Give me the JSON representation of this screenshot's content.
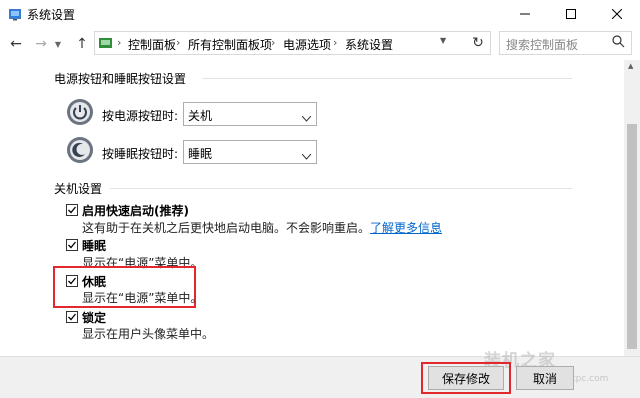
{
  "window": {
    "title": "系统设置"
  },
  "nav": {
    "breadcrumb": [
      "控制面板",
      "所有控制面板项",
      "电源选项",
      "系统设置"
    ],
    "search_placeholder": "搜索控制面板"
  },
  "power_section": {
    "title": "电源按钮和睡眠按钮设置",
    "power_button": {
      "label": "按电源按钮时:",
      "value": "关机"
    },
    "sleep_button": {
      "label": "按睡眠按钮时:",
      "value": "睡眠"
    }
  },
  "shutdown_section": {
    "title": "关机设置",
    "options": [
      {
        "title": "启用快速启动(推荐)",
        "desc": "这有助于在关机之后更快地启动电脑。不会影响重启。",
        "link": "了解更多信息",
        "checked": true
      },
      {
        "title": "睡眠",
        "desc": "显示在“电源”菜单中。",
        "checked": true
      },
      {
        "title": "休眠",
        "desc": "显示在“电源”菜单中。",
        "checked": true
      },
      {
        "title": "锁定",
        "desc": "显示在用户头像菜单中。",
        "checked": true
      }
    ]
  },
  "footer": {
    "save_label": "保存修改",
    "cancel_label": "取消"
  },
  "watermark": {
    "text": "装机之家",
    "url": "www.lotpc.com"
  },
  "colors": {
    "highlight": "#e0282d",
    "link": "#0066cc"
  }
}
